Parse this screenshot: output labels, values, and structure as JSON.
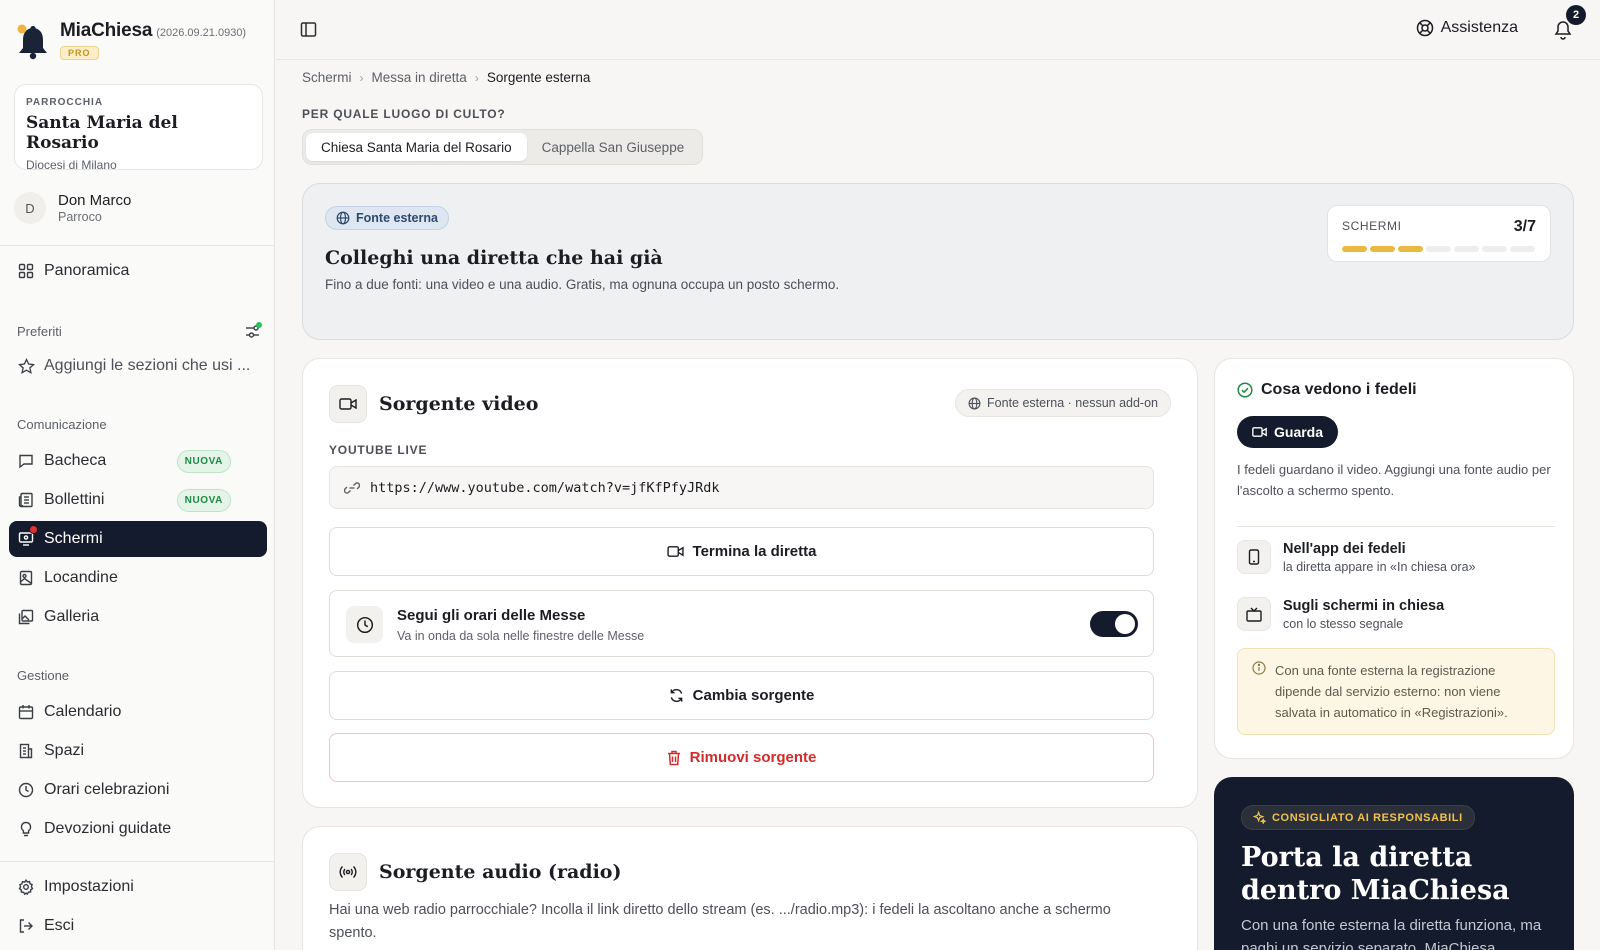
{
  "app": {
    "name": "MiaChiesa",
    "version": "(2026.09.21.0930)",
    "plan": "PRO"
  },
  "parish": {
    "kicker": "PARROCCHIA",
    "name": "Santa Maria del Rosario",
    "diocese": "Diocesi di Milano"
  },
  "user": {
    "initial": "D",
    "name": "Don Marco",
    "role": "Parroco"
  },
  "nav": {
    "overview": "Panoramica",
    "favorites_title": "Preferiti",
    "favorites_empty": "Aggiungi le sezioni che usi ...",
    "communication_title": "Comunicazione",
    "communication": [
      {
        "label": "Bacheca",
        "badge": "NUOVA"
      },
      {
        "label": "Bollettini",
        "badge": "NUOVA"
      },
      {
        "label": "Schermi"
      },
      {
        "label": "Locandine"
      },
      {
        "label": "Galleria"
      }
    ],
    "management_title": "Gestione",
    "management": [
      {
        "label": "Calendario"
      },
      {
        "label": "Spazi"
      },
      {
        "label": "Orari celebrazioni"
      },
      {
        "label": "Devozioni guidate"
      }
    ],
    "settings": "Impostazioni",
    "logout": "Esci"
  },
  "topbar": {
    "help": "Assistenza",
    "notifications": "2"
  },
  "breadcrumb": [
    "Schermi",
    "Messa in diretta",
    "Sorgente esterna"
  ],
  "location": {
    "question": "PER QUALE LUOGO DI CULTO?",
    "options": [
      "Chiesa Santa Maria del Rosario",
      "Cappella San Giuseppe"
    ],
    "selected": 0
  },
  "hero": {
    "badge": "Fonte esterna",
    "title": "Colleghi una diretta che hai già",
    "subtitle": "Fino a due fonti: una video e una audio. Gratis, ma ognuna occupa un posto schermo.",
    "screens_label": "SCHERMI",
    "screens_value": "3/7",
    "screens_used": 3,
    "screens_total": 7
  },
  "video": {
    "title": "Sorgente video",
    "tag": "Fonte esterna · nessun add-on",
    "source_label": "YOUTUBE LIVE",
    "url": "https://www.youtube.com/watch?v=jfKfPfyJRdk",
    "end_button": "Termina la diretta",
    "follow_title": "Segui gli orari delle Messe",
    "follow_desc": "Va in onda da sola nelle finestre delle Messe",
    "follow_on": true,
    "change_button": "Cambia sorgente",
    "remove_button": "Rimuovi sorgente"
  },
  "audio": {
    "title": "Sorgente audio (radio)",
    "desc": "Hai una web radio parrocchiale? Incolla il link diretto dello stream (es. .../radio.mp3): i fedeli la ascoltano anche a schermo spento."
  },
  "viewers": {
    "title": "Cosa vedono i fedeli",
    "mode_button": "Guarda",
    "desc": "I fedeli guardano il video. Aggiungi una fonte audio per l'ascolto a schermo spento.",
    "channels": [
      {
        "title": "Nell'app dei fedeli",
        "desc": "la diretta appare in «In chiesa ora»"
      },
      {
        "title": "Sugli schermi in chiesa",
        "desc": "con lo stesso segnale"
      }
    ],
    "note": "Con una fonte esterna la registrazione dipende dal servizio esterno: non viene salvata in automatico in «Registrazioni»."
  },
  "promo": {
    "tag": "CONSIGLIATO AI RESPONSABILI",
    "title": "Porta la diretta dentro MiaChiesa",
    "desc": "Con una fonte esterna la diretta funziona, ma paghi un servizio separato. MiaChiesa"
  },
  "colors": {
    "accent": "#141b2d",
    "progress": "#eab941",
    "danger": "#d22b2b",
    "success": "#22c55e"
  }
}
